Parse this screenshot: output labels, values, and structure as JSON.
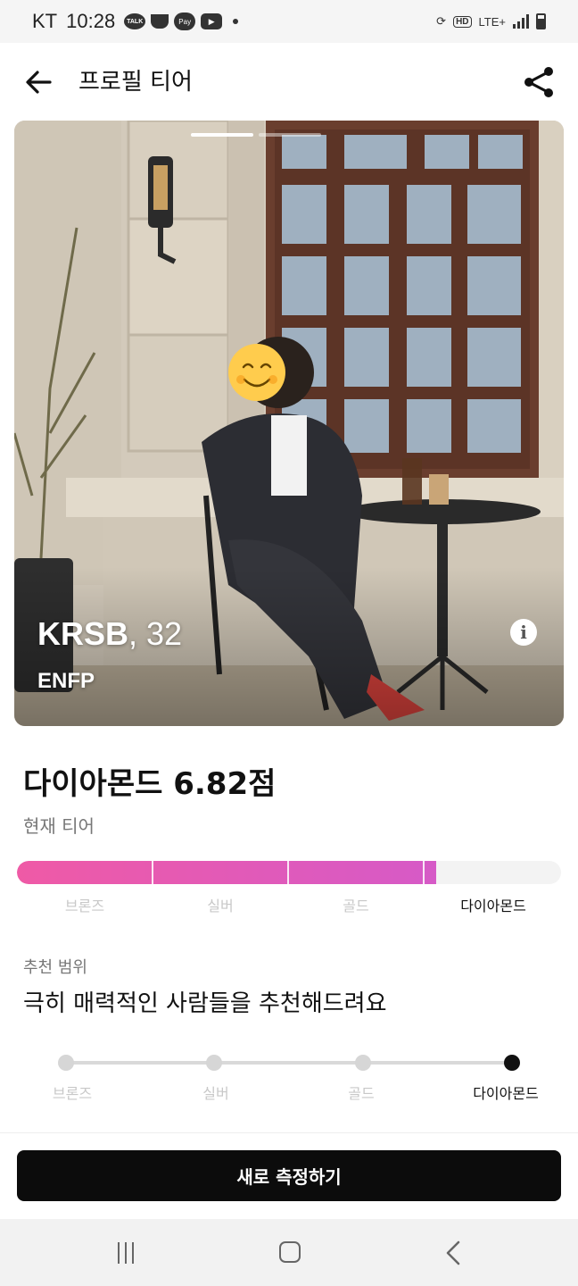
{
  "status_bar": {
    "carrier": "KT",
    "time": "10:28",
    "icons": [
      "kakaotalk-icon",
      "coffee-icon",
      "pay-icon",
      "youtube-icon",
      "notification-dot-icon",
      "sync-icon",
      "hd-voice-icon",
      "lte-icon",
      "signal-icon",
      "battery-icon"
    ],
    "talk_badge": "TALK",
    "pay_badge": "Pay",
    "hd_badge": "HD",
    "lte_badge": "LTE+"
  },
  "header": {
    "title": "프로필 티어",
    "back_icon": "arrow-left-icon",
    "share_icon": "share-icon"
  },
  "profile": {
    "name": "KRSB",
    "age_text": ", 32",
    "mbti": "ENFP",
    "photo_pages": 2,
    "active_photo_page": 1,
    "info_icon": "i"
  },
  "score": {
    "title": "다이아몬드 6.82점",
    "current_tier_label": "현재 티어",
    "tiers": [
      "브론즈",
      "실버",
      "골드",
      "다이아몬드"
    ],
    "current_tier_index": 3,
    "progress_fraction": 0.77,
    "bar_colors": {
      "start": "#ef5aa6",
      "end": "#d65ac7",
      "track": "#f3f3f3"
    }
  },
  "recommend": {
    "label": "추천 범위",
    "text": "극히 매력적인 사람들을 추천해드려요",
    "tiers": [
      "브론즈",
      "실버",
      "골드",
      "다이아몬드"
    ],
    "selected_index": 3
  },
  "actions": {
    "measure_label": "새로 측정하기"
  },
  "nav": {
    "icons": [
      "recent-apps-icon",
      "home-icon",
      "back-icon"
    ]
  }
}
